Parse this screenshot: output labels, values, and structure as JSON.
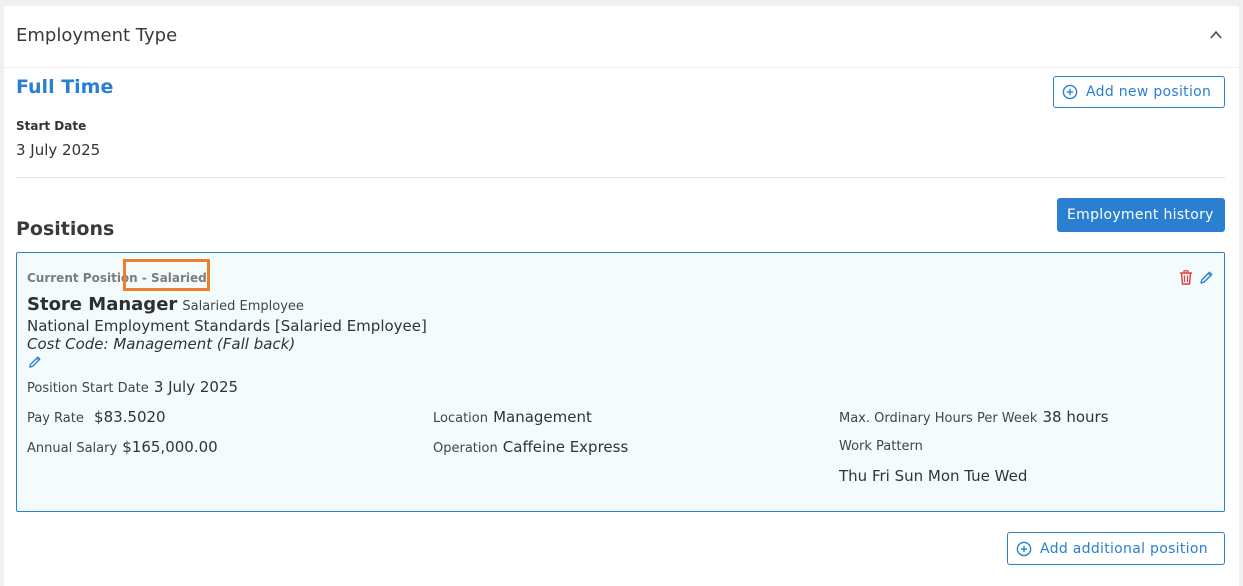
{
  "header": {
    "title": "Employment Type"
  },
  "employment": {
    "type": "Full Time",
    "start_date_label": "Start Date",
    "start_date": "3 July 2025",
    "add_position_label": "Add new position"
  },
  "positions": {
    "section_title": "Positions",
    "history_button": "Employment history",
    "current": {
      "heading": "Current Position - Salaried",
      "role": "Store Manager",
      "role_type": "Salaried Employee",
      "award": "National Employment Standards [Salaried Employee]",
      "cost_code": "Cost Code: Management (Fall back)",
      "start_label": "Position Start Date",
      "start_value": "3 July 2025",
      "pay_rate_label": "Pay Rate",
      "pay_rate_value": "$83.5020",
      "salary_label": "Annual Salary",
      "salary_value": "$165,000.00",
      "location_label": "Location",
      "location_value": "Management",
      "operation_label": "Operation",
      "operation_value": "Caffeine Express",
      "hours_label": "Max. Ordinary Hours Per Week",
      "hours_value": "38 hours",
      "pattern_label": "Work Pattern",
      "pattern_value": "Thu Fri Sun Mon Tue Wed"
    },
    "add_additional_label": "Add additional position"
  },
  "colors": {
    "accent": "#2a7fd1",
    "highlight": "#ee7f2d",
    "delete": "#e53935",
    "panel_bg": "#f3fbfd"
  }
}
